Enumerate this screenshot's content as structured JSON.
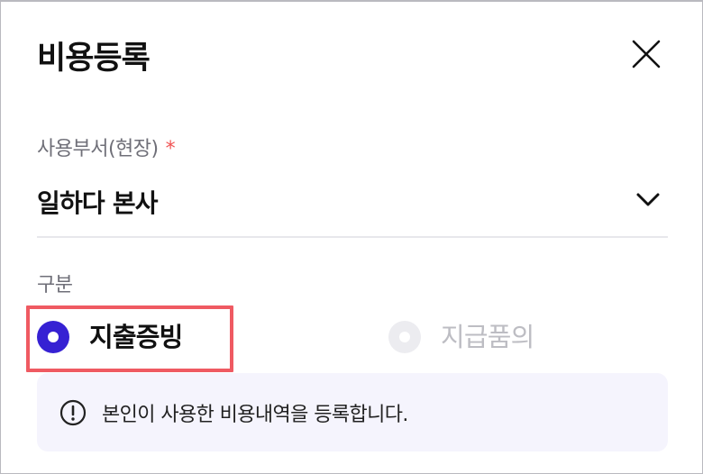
{
  "dialog": {
    "title": "비용등록",
    "close_icon": "close-icon"
  },
  "department_field": {
    "label": "사용부서(현장)",
    "required_mark": "*",
    "value": "일하다 본사",
    "dropdown_icon": "chevron-down-icon"
  },
  "category": {
    "label": "구분",
    "options": [
      {
        "label": "지출증빙",
        "state": "selected"
      },
      {
        "label": "지급품의",
        "state": "disabled"
      }
    ]
  },
  "notice": {
    "icon": "info-icon",
    "text": "본인이 사용한 비용내역을 등록합니다."
  },
  "colors": {
    "accent": "#3621d3",
    "required": "#f05454",
    "highlight_border": "#ef5a62",
    "notice_bg": "#f5f4fd"
  }
}
